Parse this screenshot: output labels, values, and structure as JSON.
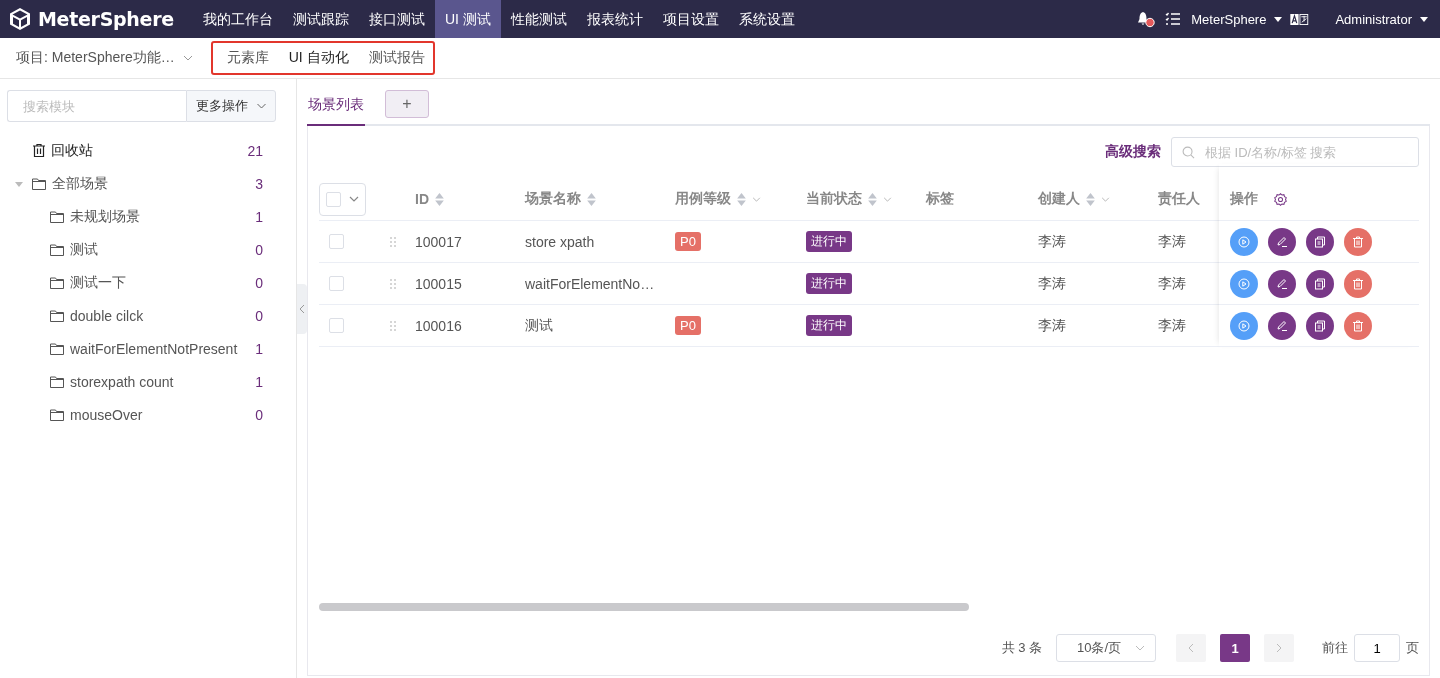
{
  "brand": {
    "name": "MeterSphere"
  },
  "nav": [
    {
      "label": "我的工作台",
      "selected": false
    },
    {
      "label": "测试跟踪",
      "selected": false
    },
    {
      "label": "接口测试",
      "selected": false
    },
    {
      "label": "UI 测试",
      "selected": true
    },
    {
      "label": "性能测试",
      "selected": false
    },
    {
      "label": "报表统计",
      "selected": false
    },
    {
      "label": "项目设置",
      "selected": false
    },
    {
      "label": "系统设置",
      "selected": false
    }
  ],
  "header_right": {
    "unread": true,
    "workspace": "MeterSphere",
    "user": "Administrator"
  },
  "subnav": {
    "project": "项目: MeterSphere功能…",
    "highlighted": true,
    "items": [
      {
        "label": "元素库",
        "selected": false
      },
      {
        "label": "UI 自动化",
        "selected": true
      },
      {
        "label": "测试报告",
        "selected": false
      }
    ]
  },
  "sidebar": {
    "search_placeholder": "搜索模块",
    "more_button": "更多操作",
    "trash": {
      "label": "回收站",
      "count": "21"
    },
    "tree": [
      {
        "label": "全部场景",
        "count": "3",
        "expanded": true,
        "children": [
          {
            "label": "未规划场景",
            "count": "1"
          },
          {
            "label": "测试",
            "count": "0"
          },
          {
            "label": "测试一下",
            "count": "0"
          },
          {
            "label": "double cilck",
            "count": "0"
          },
          {
            "label": "waitForElementNotPresent",
            "count": "1"
          },
          {
            "label": "storexpath count",
            "count": "1"
          },
          {
            "label": "mouseOver",
            "count": "0"
          }
        ]
      }
    ]
  },
  "tabs": [
    {
      "label": "场景列表",
      "selected": true
    }
  ],
  "add_tab": "+",
  "toolbar": {
    "advanced_search": "高级搜索",
    "search_placeholder": "根据 ID/名称/标签 搜索"
  },
  "table": {
    "columns": [
      {
        "label": "ID",
        "sortable": true,
        "filter": false
      },
      {
        "label": "场景名称",
        "sortable": true,
        "filter": false
      },
      {
        "label": "用例等级",
        "sortable": true,
        "filter": true
      },
      {
        "label": "当前状态",
        "sortable": true,
        "filter": true
      },
      {
        "label": "标签",
        "sortable": false,
        "filter": false
      },
      {
        "label": "创建人",
        "sortable": true,
        "filter": true
      },
      {
        "label": "责任人",
        "sortable": false,
        "filter": false
      }
    ],
    "select_all_checked": false,
    "actions_label": "操作",
    "actions": [
      {
        "kind": "run"
      },
      {
        "kind": "edit"
      },
      {
        "kind": "copy"
      },
      {
        "kind": "delete"
      }
    ],
    "rows": [
      {
        "checked": false,
        "id": "100017",
        "name": "store xpath",
        "level": "P0",
        "status": "进行中",
        "creator": "李涛",
        "owner": "李涛"
      },
      {
        "checked": false,
        "id": "100015",
        "name": "waitForElementNo…",
        "status": "进行中",
        "creator": "李涛",
        "owner": "李涛"
      },
      {
        "checked": false,
        "id": "100016",
        "name": "测试",
        "level": "P0",
        "status": "进行中",
        "creator": "李涛",
        "owner": "李涛"
      }
    ]
  },
  "pagination": {
    "total": "共 3 条",
    "page_size": "10条/页",
    "pages": [
      {
        "label": "1",
        "selected": true
      }
    ],
    "goto_label": "前往",
    "goto_value": "1",
    "page_unit": "页"
  }
}
